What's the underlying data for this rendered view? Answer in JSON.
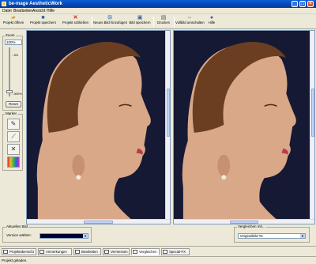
{
  "window": {
    "title": "be-mage AestheticWork"
  },
  "menu": [
    "Datei",
    "Bearbeiten",
    "Ansicht",
    "Hilfe"
  ],
  "toolbar": [
    {
      "label": "Projekt öffnen",
      "icon": "folder-open-icon"
    },
    {
      "label": "Projekt speichern",
      "icon": "save-icon"
    },
    {
      "label": "Projekt schließen",
      "icon": "close-icon"
    },
    {
      "label": "Neues Bild hinzufügen",
      "icon": "add-image-icon"
    },
    {
      "label": "Bild speichern",
      "icon": "save-image-icon"
    },
    {
      "label": "Drucken",
      "icon": "print-icon"
    },
    {
      "label": "Vollbild umschalten",
      "icon": "fullscreen-icon"
    },
    {
      "label": "Hilfe",
      "icon": "help-icon"
    }
  ],
  "zoom": {
    "title": "Zoom",
    "value": "100%",
    "ticks": [
      "- 5%",
      "- 300%"
    ],
    "reset_label": "Reset"
  },
  "marker": {
    "title": "Marker"
  },
  "current_image": {
    "title": "Aktuelles Bild",
    "version_label": "Version wählen:",
    "selected_color": "#000033"
  },
  "compare": {
    "title": "Vergleichen mit...",
    "selected": "Originalbild #2"
  },
  "tabs": [
    "Projektübersicht",
    "Anmerkungen",
    "Bearbeiten",
    "Vermessen",
    "Vergleichen",
    "Special-FX"
  ],
  "status": {
    "text": "Projekt geladen."
  },
  "colors": {
    "photo_background": "#151934",
    "accent": "#0845b4"
  }
}
